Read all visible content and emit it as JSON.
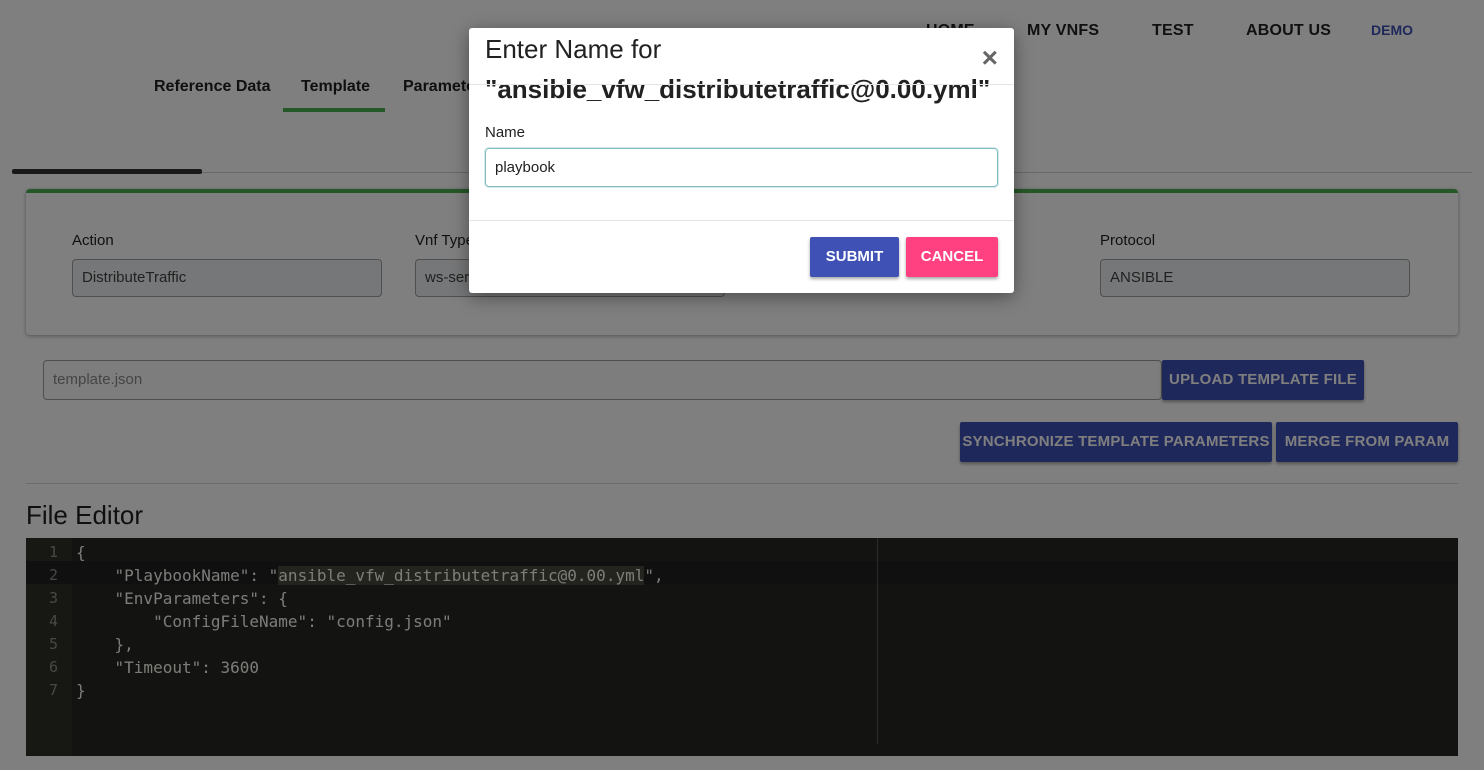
{
  "nav": {
    "items": [
      "HOME",
      "MY VNFS",
      "TEST",
      "ABOUT US"
    ],
    "user": "DEMO"
  },
  "tabs": [
    "Reference Data",
    "Template",
    "Parameter"
  ],
  "form": {
    "action_label": "Action",
    "action_value": "DistributeTraffic",
    "vnf_type_label": "Vnf Type",
    "vnf_type_value": "ws-ser",
    "protocol_label": "Protocol",
    "protocol_value": "ANSIBLE"
  },
  "upload": {
    "file_name": "template.json",
    "button_label": "UPLOAD TEMPLATE FILE"
  },
  "actions": {
    "sync_label": "SYNCHRONIZE TEMPLATE PARAMETERS",
    "merge_label": "MERGE FROM PARAM"
  },
  "editor": {
    "title": "File Editor",
    "lines": [
      {
        "num": "1",
        "pre": "{",
        "hl": "",
        "post": ""
      },
      {
        "num": "2",
        "pre": "    \"PlaybookName\": \"",
        "hl": "ansible_vfw_distributetraffic@0.00.yml",
        "post": "\","
      },
      {
        "num": "3",
        "pre": "    \"EnvParameters\": {",
        "hl": "",
        "post": ""
      },
      {
        "num": "4",
        "pre": "        \"ConfigFileName\": \"config.json\"",
        "hl": "",
        "post": ""
      },
      {
        "num": "5",
        "pre": "    },",
        "hl": "",
        "post": ""
      },
      {
        "num": "6",
        "pre": "    \"Timeout\": 3600",
        "hl": "",
        "post": ""
      },
      {
        "num": "7",
        "pre": "}",
        "hl": "",
        "post": ""
      }
    ]
  },
  "modal": {
    "title_line1": "Enter Name for",
    "title_line2": "\"ansible_vfw_distributetraffic@0.00.yml\"",
    "close_glyph": "×",
    "name_label": "Name",
    "name_value": "playbook",
    "submit_label": "SUBMIT",
    "cancel_label": "CANCEL"
  },
  "colors": {
    "primary": "#3f51b5",
    "accent": "#ff4081",
    "success": "#4caf50",
    "editor_bg": "#272822"
  }
}
